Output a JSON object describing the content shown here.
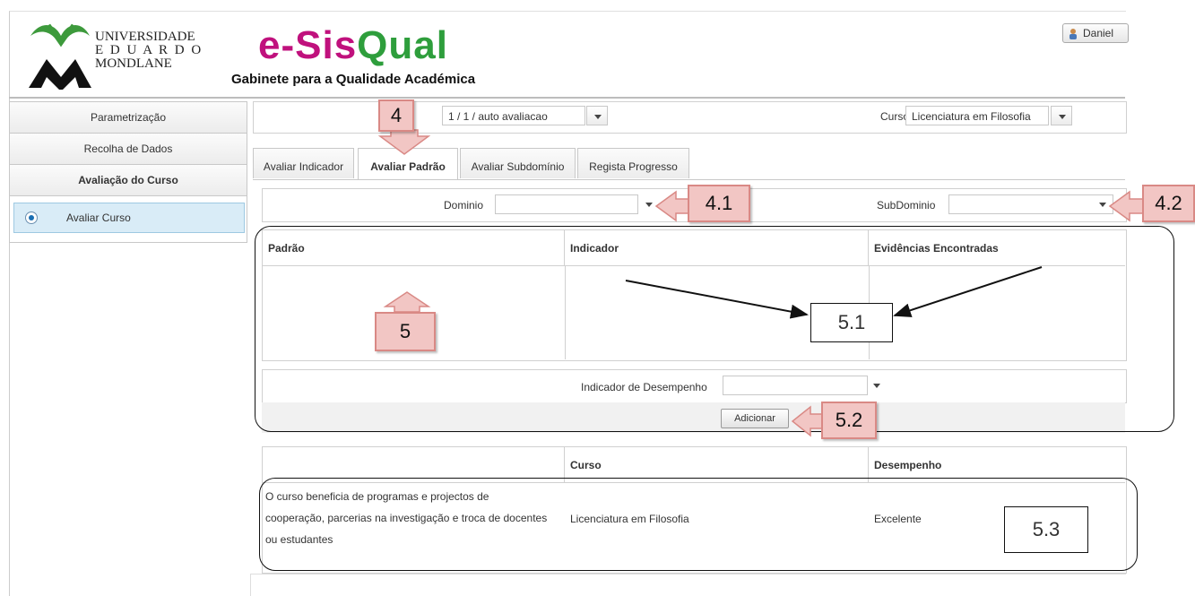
{
  "header": {
    "uem_lines": [
      "UNIVERSIDADE",
      "E D U A R D O",
      "MONDLANE"
    ],
    "app_name_e": "e-",
    "app_name_sis": "Sis",
    "app_name_qual": "Qual",
    "subtitle": "Gabinete para a Qualidade Académica",
    "user_label": "Daniel"
  },
  "sidebar": {
    "sections": [
      "Parametrização",
      "Recolha de Dados",
      "Avaliação do Curso"
    ],
    "active_item": "Avaliar Curso"
  },
  "toolbar": {
    "period_value": "1 / 1 / auto avaliacao",
    "course_label": "Curso",
    "course_value": "Licenciatura em Filosofia"
  },
  "tabs": [
    "Avaliar Indicador",
    "Avaliar Padrão",
    "Avaliar Subdomínio",
    "Regista Progresso"
  ],
  "filters": {
    "domain_label": "Dominio",
    "subdomain_label": "SubDominio"
  },
  "grid": {
    "headers": [
      "Padrão",
      "Indicador",
      "Evidências Encontradas"
    ]
  },
  "performance": {
    "label": "Indicador de Desempenho",
    "add_button": "Adicionar"
  },
  "results": {
    "headers": [
      "",
      "Curso",
      "Desempenho"
    ],
    "rows": [
      {
        "description_lines": [
          "O curso beneficia de programas e projectos de",
          "cooperação, parcerias na investigação e troca de docentes",
          "ou estudantes"
        ],
        "course": "Licenciatura em Filosofia",
        "performance": "Excelente"
      }
    ]
  },
  "annotations": {
    "c4": "4",
    "c41": "4.1",
    "c42": "4.2",
    "c5": "5",
    "c51": "5.1",
    "c52": "5.2",
    "c53": "5.3"
  },
  "colors": {
    "brand_magenta": "#c0117d",
    "brand_green": "#2e9e3c",
    "callout_fill": "#f2c6c4",
    "callout_border": "#d98985",
    "selected_bg": "#d9ecf7"
  }
}
